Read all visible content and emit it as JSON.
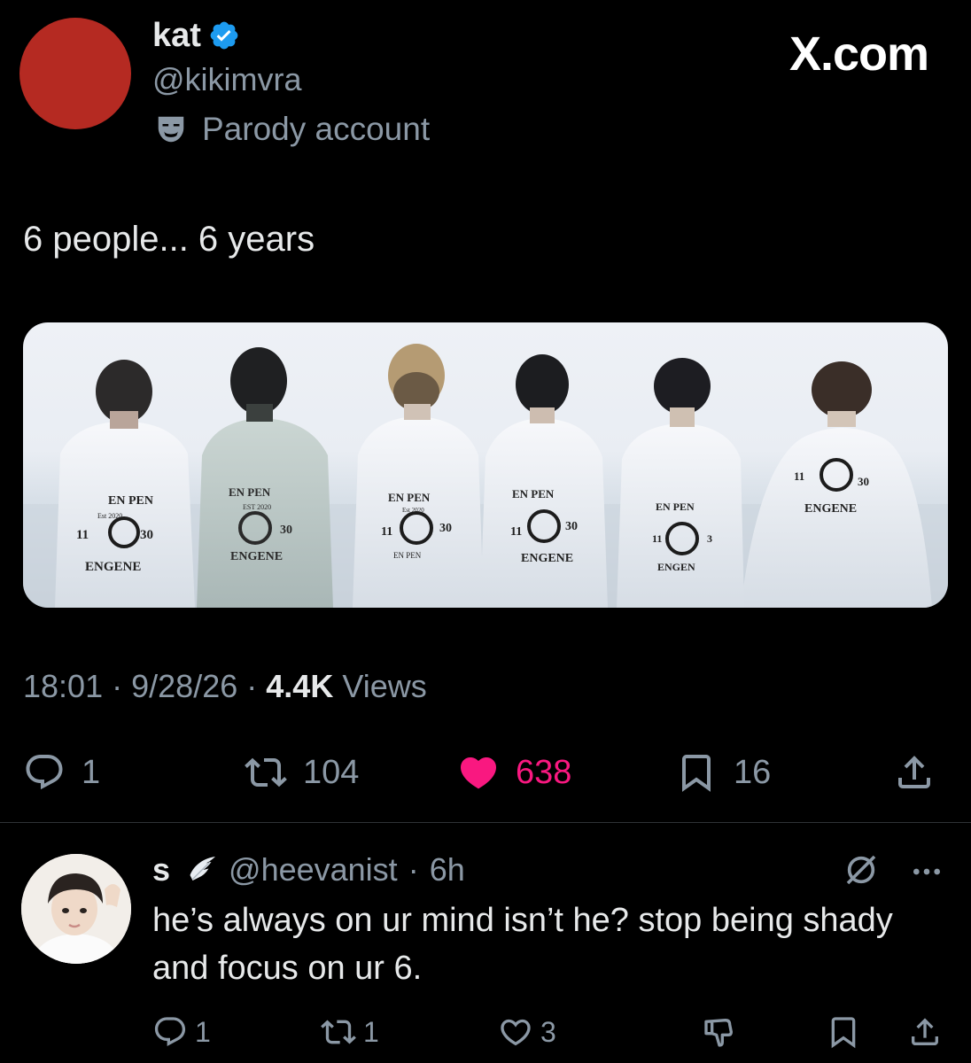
{
  "brand": "X.com",
  "tweet": {
    "author_name": "kat",
    "handle": "@kikimvra",
    "label": "Parody account",
    "text": "6 people... 6 years",
    "time": "18:01",
    "date": "9/28/26",
    "views_count": "4.4K",
    "views_label": "Views",
    "separator": "·",
    "replies": "1",
    "reposts": "104",
    "likes": "638",
    "bookmarks": "16",
    "liked": true,
    "media_texts": {
      "p1": {
        "top": "EN PEN",
        "mid": "Est 2020",
        "left": "11",
        "right": "30",
        "bottom": "ENGENE"
      },
      "p2": {
        "top": "EN PEN",
        "mid": "EST 2020",
        "right": "30",
        "bottom": "ENGENE"
      },
      "p3": {
        "top": "EN PEN",
        "mid": "Est 2020",
        "left": "11",
        "right": "30",
        "bottom": "EN PEN"
      },
      "p4": {
        "top": "EN PEN",
        "left": "11",
        "right": "30",
        "bottom": "ENGENE"
      },
      "p5": {
        "top": "EN PEN",
        "left": "11",
        "right": "3",
        "bottom": "ENGEN"
      },
      "p6": {
        "left": "11",
        "right": "30",
        "bottom": "ENGENE"
      }
    }
  },
  "reply": {
    "author_name": "s",
    "handle": "@heevanist",
    "separator": "·",
    "time": "6h",
    "text": "he’s always on ur mind isn’t he? stop being shady and focus on ur 6.",
    "replies": "1",
    "reposts": "1",
    "likes": "3"
  },
  "colors": {
    "background": "#000000",
    "secondary_text": "#8b98a5",
    "like_active": "#f91880",
    "verified": "#1d9bf0",
    "avatar_main": "#b52a22"
  },
  "icons": [
    "verified-badge-icon",
    "parody-mask-icon",
    "reply-icon",
    "repost-icon",
    "like-icon",
    "bookmark-icon",
    "share-icon",
    "wing-emoji-icon",
    "grok-icon",
    "more-icon",
    "downvote-icon"
  ]
}
